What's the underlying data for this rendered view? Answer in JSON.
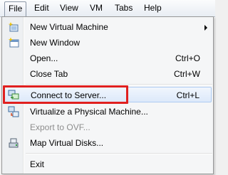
{
  "menubar": {
    "items": [
      {
        "label": "File"
      },
      {
        "label": "Edit"
      },
      {
        "label": "View"
      },
      {
        "label": "VM"
      },
      {
        "label": "Tabs"
      },
      {
        "label": "Help"
      }
    ]
  },
  "file_menu": {
    "items": [
      {
        "label": "New Virtual Machine",
        "shortcut": "",
        "icon": "new-vm-icon",
        "submenu": true
      },
      {
        "label": "New Window",
        "shortcut": "",
        "icon": "new-window-icon"
      },
      {
        "label": "Open...",
        "shortcut": "Ctrl+O"
      },
      {
        "label": "Close Tab",
        "shortcut": "Ctrl+W"
      },
      {
        "label": "Connect to Server...",
        "shortcut": "Ctrl+L",
        "icon": "connect-server-icon",
        "highlighted": true
      },
      {
        "label": "Virtualize a Physical Machine...",
        "shortcut": "",
        "icon": "virtualize-icon"
      },
      {
        "label": "Export to OVF...",
        "shortcut": "",
        "disabled": true
      },
      {
        "label": "Map Virtual Disks...",
        "shortcut": "",
        "icon": "map-disks-icon"
      },
      {
        "label": "Exit",
        "shortcut": ""
      }
    ]
  },
  "colors": {
    "annotation_box": "#e0201f",
    "highlight_bg": "#dde9fa",
    "disabled_text": "#8d8d8d"
  }
}
